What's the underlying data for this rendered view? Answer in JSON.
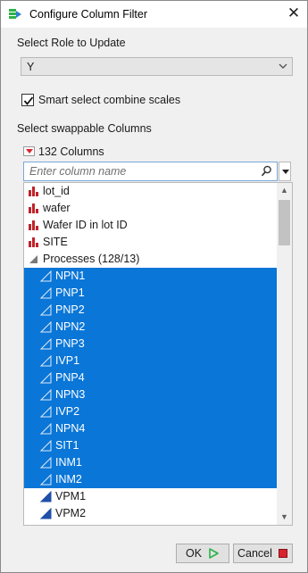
{
  "window": {
    "title": "Configure Column Filter",
    "close_label": "✕"
  },
  "role": {
    "label": "Select Role to Update",
    "value": "Y"
  },
  "smart_select": {
    "label": "Smart select combine scales",
    "checked": true
  },
  "columns": {
    "label": "Select swappable Columns",
    "count_label": "132 Columns",
    "search_placeholder": "Enter column name",
    "items": [
      {
        "label": "lot_id",
        "icon": "nominal-bar-icon",
        "selected": false,
        "indent": 0
      },
      {
        "label": "wafer",
        "icon": "nominal-bar-icon",
        "selected": false,
        "indent": 0
      },
      {
        "label": "Wafer ID in lot ID",
        "icon": "nominal-bar-icon",
        "selected": false,
        "indent": 0
      },
      {
        "label": "SITE",
        "icon": "nominal-bar-icon",
        "selected": false,
        "indent": 0
      },
      {
        "label": "Processes (128/13)",
        "icon": "group-triangle-icon",
        "selected": false,
        "indent": 0
      },
      {
        "label": "NPN1",
        "icon": "continuous-icon",
        "selected": true,
        "indent": 1
      },
      {
        "label": "PNP1",
        "icon": "continuous-icon",
        "selected": true,
        "indent": 1
      },
      {
        "label": "PNP2",
        "icon": "continuous-icon",
        "selected": true,
        "indent": 1
      },
      {
        "label": "NPN2",
        "icon": "continuous-icon",
        "selected": true,
        "indent": 1
      },
      {
        "label": "PNP3",
        "icon": "continuous-icon",
        "selected": true,
        "indent": 1
      },
      {
        "label": "IVP1",
        "icon": "continuous-icon",
        "selected": true,
        "indent": 1
      },
      {
        "label": "PNP4",
        "icon": "continuous-icon",
        "selected": true,
        "indent": 1
      },
      {
        "label": "NPN3",
        "icon": "continuous-icon",
        "selected": true,
        "indent": 1
      },
      {
        "label": "IVP2",
        "icon": "continuous-icon",
        "selected": true,
        "indent": 1
      },
      {
        "label": "NPN4",
        "icon": "continuous-icon",
        "selected": true,
        "indent": 1
      },
      {
        "label": "SIT1",
        "icon": "continuous-icon",
        "selected": true,
        "indent": 1
      },
      {
        "label": "INM1",
        "icon": "continuous-icon",
        "selected": true,
        "indent": 1
      },
      {
        "label": "INM2",
        "icon": "continuous-icon",
        "selected": true,
        "indent": 1
      },
      {
        "label": "VPM1",
        "icon": "continuous-icon",
        "selected": false,
        "indent": 1
      },
      {
        "label": "VPM2",
        "icon": "continuous-icon",
        "selected": false,
        "indent": 1
      }
    ]
  },
  "buttons": {
    "ok_label": "OK",
    "cancel_label": "Cancel"
  },
  "colors": {
    "selection": "#0a76d7",
    "nominal_icon": "#c0232b",
    "continuous_icon": "#1f4fa8",
    "ok_icon": "#2db24a",
    "cancel_icon": "#d8242f"
  }
}
